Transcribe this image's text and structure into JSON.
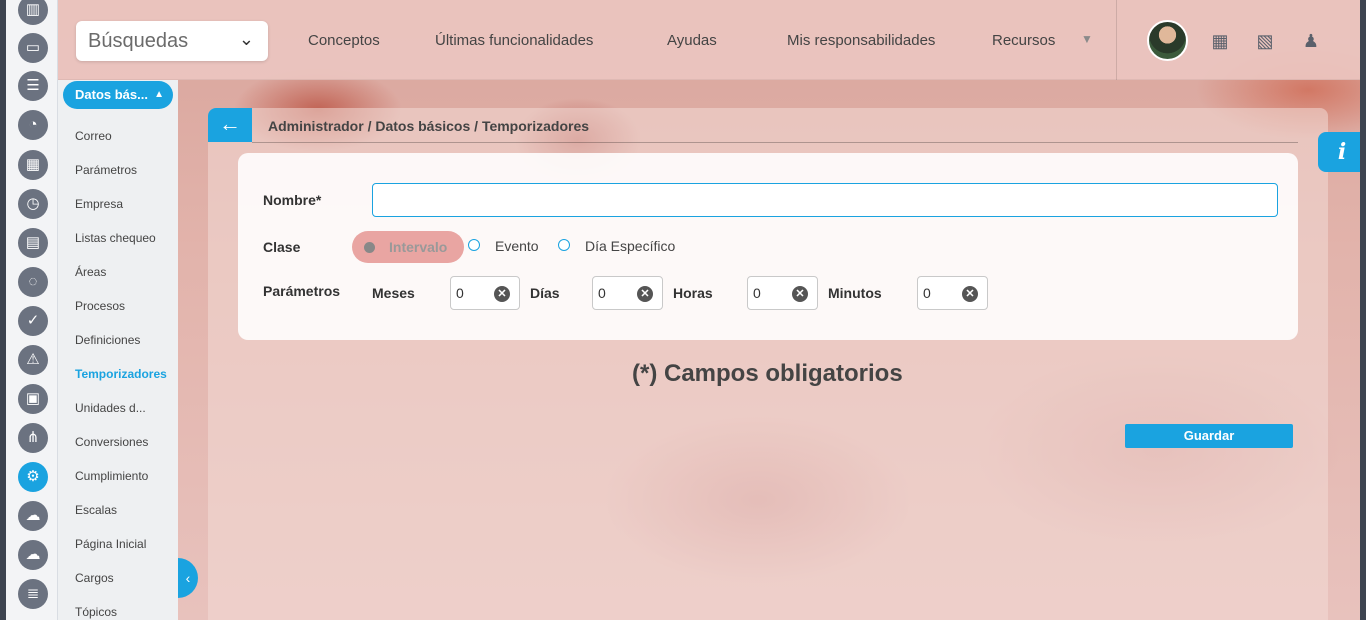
{
  "header": {
    "search_label": "Búsquedas",
    "nav": [
      "Conceptos",
      "Últimas funcionalidades",
      "Ayudas",
      "Mis responsabilidades",
      "Recursos"
    ]
  },
  "subnav": {
    "section_label": "Datos bás...",
    "items": [
      "Correo",
      "Parámetros",
      "Empresa",
      "Listas chequeo",
      "Áreas",
      "Procesos",
      "Definiciones",
      "Temporizadores",
      "Unidades d...",
      "Conversiones",
      "Cumplimiento",
      "Escalas",
      "Página Inicial",
      "Cargos",
      "Tópicos"
    ],
    "active_item": "Temporizadores"
  },
  "panel": {
    "breadcrumb": "Administrador / Datos básicos / Temporizadores",
    "form": {
      "name_label": "Nombre*",
      "name_value": "",
      "class_label": "Clase",
      "class_options": [
        "Intervalo",
        "Evento",
        "Día Específico"
      ],
      "class_selected": "Intervalo",
      "params_label": "Parámetros",
      "params": [
        {
          "label": "Meses",
          "value": "0"
        },
        {
          "label": "Días",
          "value": "0"
        },
        {
          "label": "Horas",
          "value": "0"
        },
        {
          "label": "Minutos",
          "value": "0"
        }
      ]
    },
    "required_note": "(*) Campos obligatorios",
    "save_label": "Guardar"
  },
  "info_label": "i",
  "colors": {
    "accent": "#1aa3e0",
    "chip": "#e9a5a2"
  }
}
